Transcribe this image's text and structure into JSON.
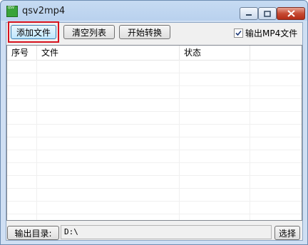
{
  "window": {
    "title": "qsv2mp4",
    "app_icon_text": "QSV"
  },
  "toolbar": {
    "add_file": "添加文件",
    "clear_list": "清空列表",
    "start_convert": "开始转换",
    "output_mp4_label": "输出MP4文件",
    "output_mp4_checked": true
  },
  "list": {
    "columns": [
      "序号",
      "文件",
      "状态",
      ""
    ],
    "rows": []
  },
  "footer": {
    "output_dir_label": "输出目录:",
    "output_dir_value": "D:\\",
    "browse_label": "选择"
  },
  "colors": {
    "highlight": "#d6121e",
    "title_bar": "#c6dbf2"
  }
}
